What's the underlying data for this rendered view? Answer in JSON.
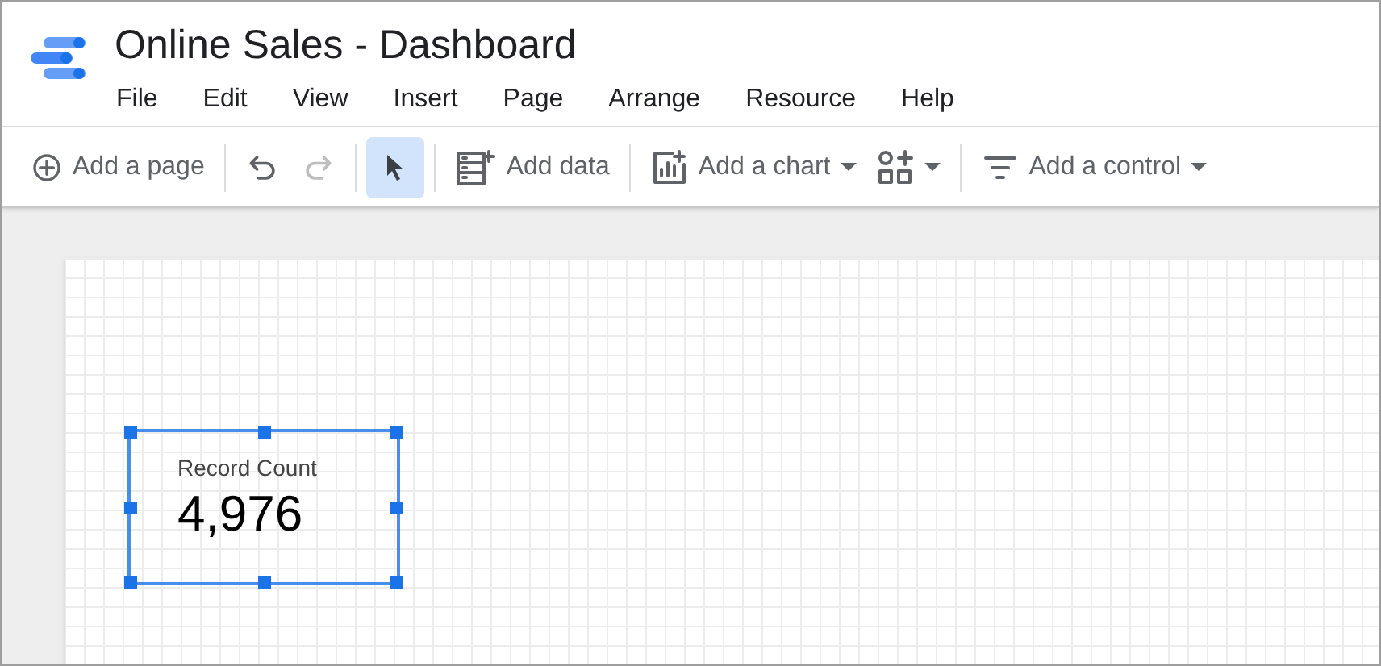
{
  "window": {
    "title": "Online Sales - Dashboard"
  },
  "menu": [
    "File",
    "Edit",
    "View",
    "Insert",
    "Page",
    "Arrange",
    "Resource",
    "Help"
  ],
  "toolbar": [
    {
      "kind": "add-page",
      "label": "Add a page",
      "disabled": false,
      "selected": false,
      "dropdown": false
    },
    {
      "kind": "undo",
      "disabled": false,
      "selected": false,
      "dropdown": false
    },
    {
      "kind": "redo",
      "disabled": true,
      "selected": false,
      "dropdown": false
    },
    {
      "kind": "select",
      "disabled": false,
      "selected": true,
      "dropdown": false
    },
    {
      "kind": "add-data",
      "label": "Add data",
      "disabled": false,
      "selected": false,
      "dropdown": false
    },
    {
      "kind": "add-chart",
      "label": "Add a chart",
      "disabled": false,
      "selected": false,
      "dropdown": true
    },
    {
      "kind": "components",
      "disabled": false,
      "selected": false,
      "dropdown": true
    },
    {
      "kind": "add-control",
      "label": "Add a control",
      "disabled": false,
      "selected": false,
      "dropdown": true
    }
  ],
  "scorecard": {
    "label": "Record Count",
    "value": "4,976",
    "selected": true
  }
}
